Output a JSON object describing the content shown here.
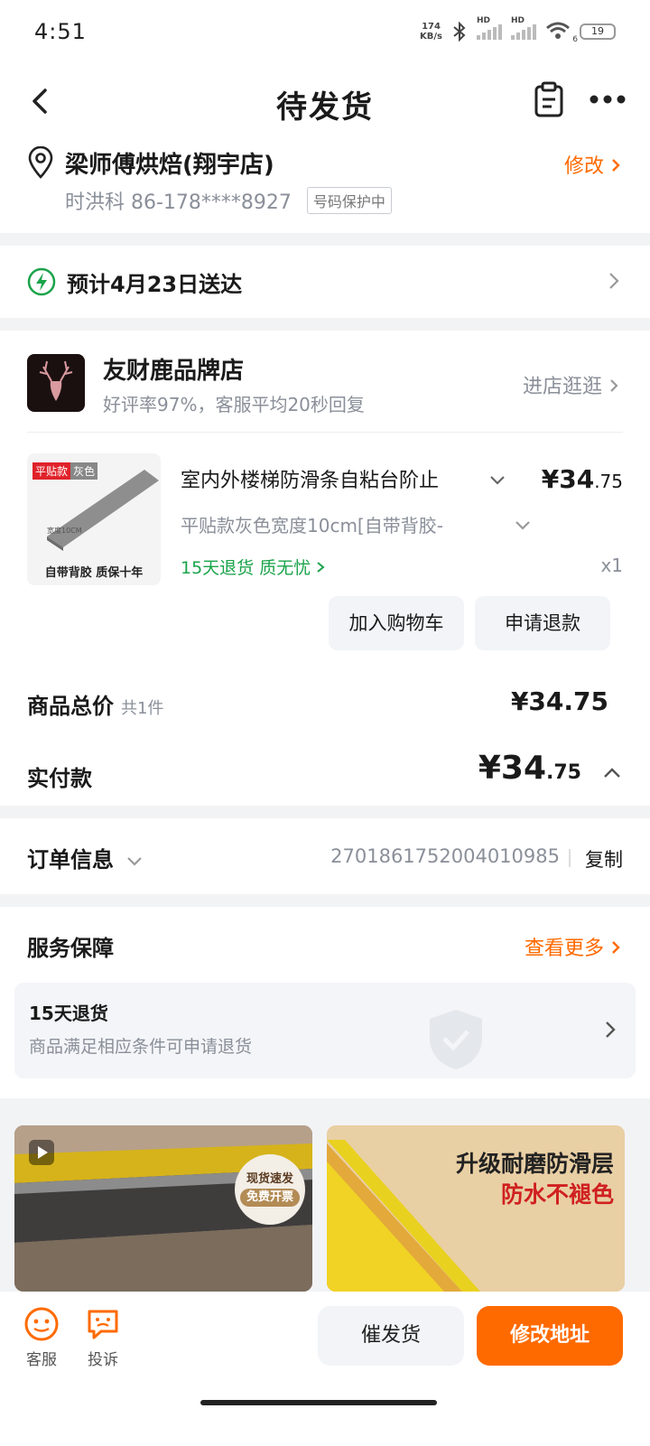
{
  "status": {
    "time": "4:51",
    "net_speed": "174",
    "net_unit": "KB/s",
    "hd1": "HD",
    "hd2": "HD",
    "wifi_num": "6",
    "battery": "19"
  },
  "header": {
    "title": "待发货"
  },
  "address": {
    "name": "梁师傅烘焙(翔宇店)",
    "phone": "时洪科 86-178****8927",
    "privacy_tag": "号码保护中",
    "edit_label": "修改"
  },
  "delivery": {
    "text": "预计4月23日送达"
  },
  "shop": {
    "name": "友财鹿品牌店",
    "subtitle": "好评率97%，客服平均20秒回复",
    "visit_label": "进店逛逛"
  },
  "product": {
    "name": "室内外楼梯防滑条自粘台阶止",
    "spec": "平贴款灰色宽度10cm[自带背胶-",
    "guarantee": "15天退货  质无忧",
    "price_main": "¥34",
    "price_decimal": ".75",
    "qty": "x1",
    "thumb_tag1": "平贴款",
    "thumb_tag2": "灰色",
    "thumb_caption": "自带背胶  质保十年",
    "thumb_width_note": "宽度10CM"
  },
  "actions": {
    "add_cart": "加入购物车",
    "refund": "申请退款"
  },
  "totals": {
    "goods_label": "商品总价",
    "goods_count": "共1件",
    "goods_price": "¥34.75",
    "paid_label": "实付款",
    "paid_main": "¥34",
    "paid_decimal": ".75"
  },
  "order": {
    "label": "订单信息",
    "number": "2701861752004010985",
    "copy_label": "复制"
  },
  "service": {
    "label": "服务保障",
    "more_label": "查看更多",
    "item_title": "15天退货",
    "item_sub": "商品满足相应条件可申请退货"
  },
  "recommend": {
    "badge_line1": "现货速发",
    "badge_line2": "免费开票",
    "banner_line1": "升级耐磨防滑层",
    "banner_line2": "防水不褪色"
  },
  "bottom": {
    "service_label": "客服",
    "complain_label": "投诉",
    "urge_label": "催发货",
    "modify_label": "修改地址"
  },
  "colors": {
    "accent": "#ff6a00",
    "green": "#1aa34a",
    "muted": "#8a8f99"
  }
}
